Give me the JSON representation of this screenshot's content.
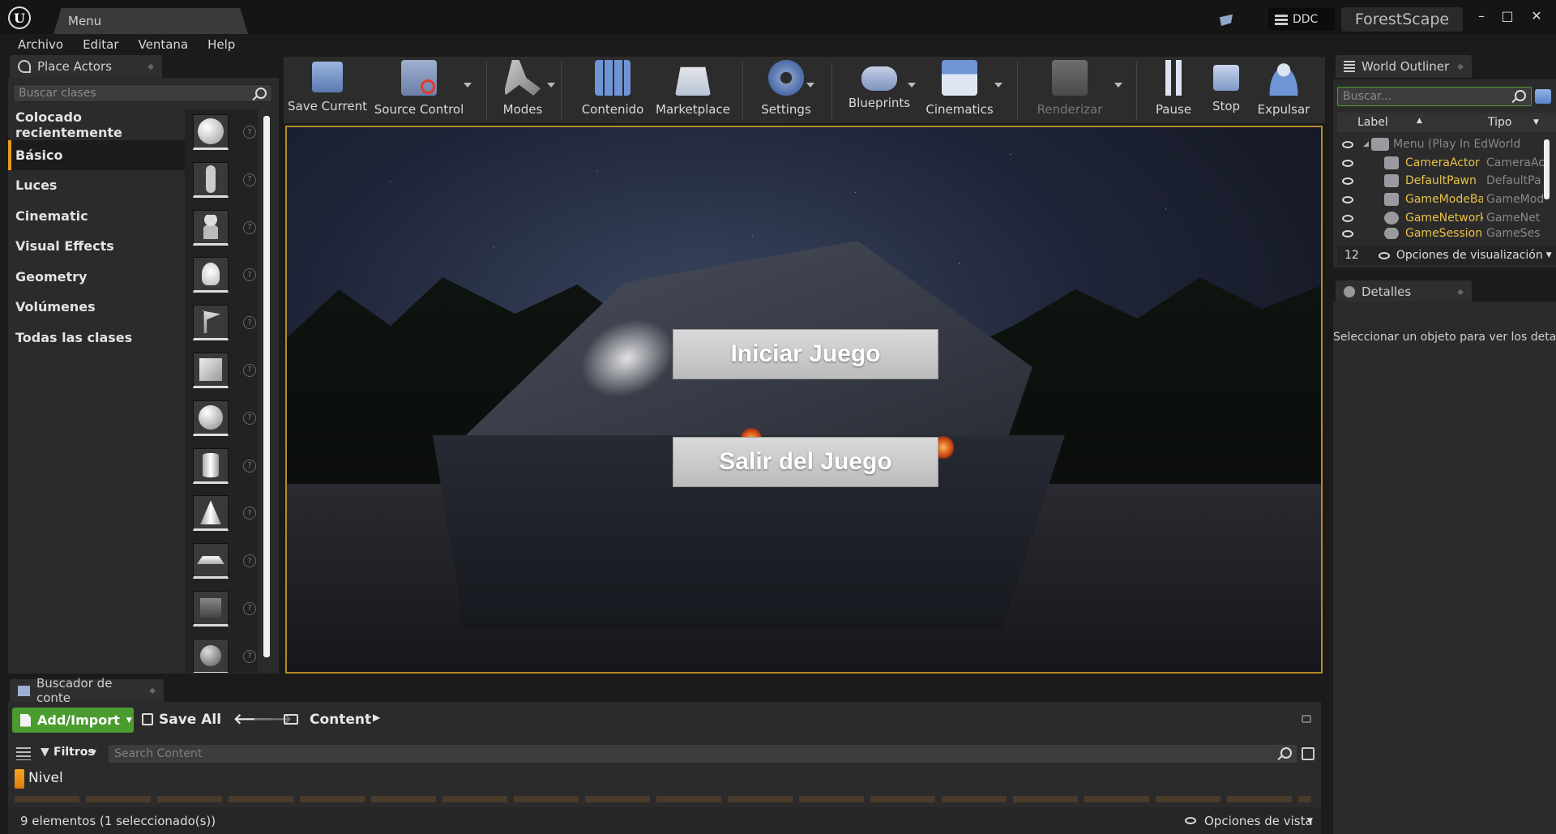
{
  "window": {
    "tab_title": "Menu",
    "ddc_label": "DDC",
    "project_name": "ForestScape",
    "minimize": "–",
    "maximize": "□",
    "close": "✕"
  },
  "menu": [
    "Archivo",
    "Editar",
    "Ventana",
    "Help"
  ],
  "place_actors": {
    "tab_label": "Place Actors",
    "search_placeholder": "Buscar clases",
    "categories": [
      "Colocado recientemente",
      "Básico",
      "Luces",
      "Cinematic",
      "Visual Effects",
      "Geometry",
      "Volúmenes",
      "Todas las clases"
    ],
    "active_category": "Básico"
  },
  "toolbar": {
    "save_current": "Save Current",
    "source_control": "Source Control",
    "modes": "Modes",
    "contenido": "Contenido",
    "marketplace": "Marketplace",
    "settings": "Settings",
    "blueprints": "Blueprints",
    "cinematics": "Cinematics",
    "renderizar": "Renderizar",
    "pause": "Pause",
    "stop": "Stop",
    "expulsar": "Expulsar"
  },
  "viewport": {
    "start_button": "Iniciar Juego",
    "exit_button": "Salir del Juego"
  },
  "world_outliner": {
    "tab_label": "World Outliner",
    "search_placeholder": "Buscar...",
    "col_label": "Label",
    "col_type": "Tipo",
    "root_row": "Menu (Play In EdWorld",
    "rows": [
      {
        "label": "CameraActor",
        "type": "CameraAc"
      },
      {
        "label": "DefaultPawn",
        "type": "DefaultPa"
      },
      {
        "label": "GameModeBas",
        "type": "GameMod"
      },
      {
        "label": "GameNetworkI",
        "type": "GameNet"
      },
      {
        "label": "GameSession",
        "type": "GameSes"
      }
    ],
    "count": "12",
    "view_options": "Opciones de visualización"
  },
  "details": {
    "tab_label": "Detalles",
    "empty_text": "Seleccionar un objeto para ver los detall"
  },
  "content_browser": {
    "tab_label": "Buscador de conte",
    "add_import": "Add/Import",
    "save_all": "Save All",
    "path": "Content",
    "filters": "Filtros",
    "search_placeholder": "Search Content",
    "nivel": "Nivel",
    "status": "9 elementos (1 seleccionado(s))",
    "view_options": "Opciones de vista"
  },
  "colors": {
    "accent": "#e89a1c",
    "add_green": "#4a9c2f",
    "outliner_label": "#e8c14a"
  }
}
